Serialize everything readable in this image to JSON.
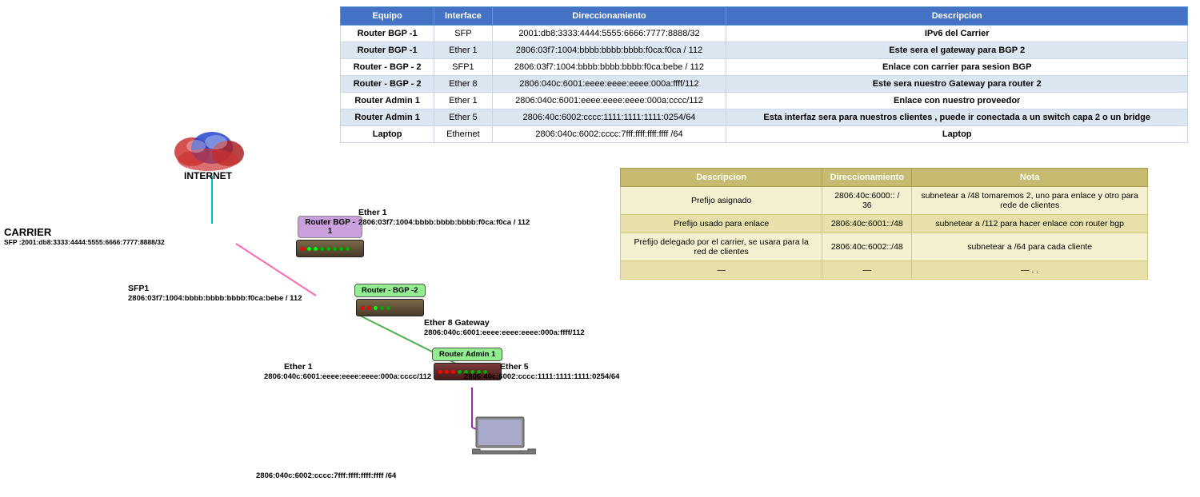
{
  "mainTable": {
    "headers": [
      "Equipo",
      "Interface",
      "Direccionamiento",
      "Descripcion"
    ],
    "rows": [
      {
        "equipo": "Router BGP -1",
        "interface": "SFP",
        "direccionamiento": "2001:db8:3333:4444:5555:6666:7777:8888/32",
        "descripcion": "IPv6 del Carrier"
      },
      {
        "equipo": "Router BGP -1",
        "interface": "Ether 1",
        "direccionamiento": "2806:03f7:1004:bbbb:bbbb:bbbb:f0ca:f0ca / 112",
        "descripcion": "Este sera el gateway para BGP 2"
      },
      {
        "equipo": "Router - BGP - 2",
        "interface": "SFP1",
        "direccionamiento": "2806:03f7:1004:bbbb:bbbb:bbbb:f0ca:bebe / 112",
        "descripcion": "Enlace con carrier para sesion BGP"
      },
      {
        "equipo": "Router - BGP - 2",
        "interface": "Ether 8",
        "direccionamiento": "2806:040c:6001:eeee:eeee:eeee:000a:ffff/112",
        "descripcion": "Este sera nuestro Gateway para router 2"
      },
      {
        "equipo": "Router Admin 1",
        "interface": "Ether 1",
        "direccionamiento": "2806:040c:6001:eeee:eeee:eeee:000a:cccc/112",
        "descripcion": "Enlace con nuestro proveedor"
      },
      {
        "equipo": "Router Admin 1",
        "interface": "Ether 5",
        "direccionamiento": "2806:40c:6002:cccc:1111:1111:1111:0254/64",
        "descripcion": "Esta interfaz sera para nuestros clientes , puede ir conectada a un switch capa 2 o un bridge"
      },
      {
        "equipo": "Laptop",
        "interface": "Ethernet",
        "direccionamiento": "2806:040c:6002:cccc:7fff:ffff:ffff:ffff /64",
        "descripcion": "Laptop"
      }
    ]
  },
  "secondaryTable": {
    "headers": [
      "Descripcion",
      "Direccionamiento",
      "Nota"
    ],
    "rows": [
      {
        "descripcion": "Prefijo asignado",
        "direccionamiento": "2806:40c:6000:: / 36",
        "nota": "subnetear a /48  tomaremos 2, uno para enlace y otro para rede de clientes"
      },
      {
        "descripcion": "Prefijo usado para enlace",
        "direccionamiento": "2806:40c:6001::/48",
        "nota": "subnetear a /112 para hacer enlace con router bgp"
      },
      {
        "descripcion": "Prefijo delegado por el carrier, se usara para la red de clientes",
        "direccionamiento": "2806:40c:6002::/48",
        "nota": "subnetear a /64 para cada cliente"
      },
      {
        "descripcion": "—",
        "direccionamiento": "—",
        "nota": "— . ."
      }
    ]
  },
  "diagram": {
    "internet_label": "INTERNET",
    "carrier_label": "CARRIER",
    "carrier_sfp": "SFP :2001:db8:3333:4444:5555:6666:7777:8888/32",
    "router_bgp1_label": "Router BGP -\n1",
    "router_bgp1_ether1": "Ether 1",
    "router_bgp1_ether1_addr": "2806:03f7:1004:bbbb:bbbb:bbbb:f0ca:f0ca / 112",
    "router_bgp2_label": "Router - BGP -2",
    "router_bgp2_sfp1": "SFP1",
    "router_bgp2_sfp1_addr": "2806:03f7:1004:bbbb:bbbb:bbbb:f0ca:bebe / 112",
    "router_bgp2_ether8": "Ether 8 Gateway",
    "router_bgp2_ether8_addr": "2806:040c:6001:eeee:eeee:eeee:000a:ffff/112",
    "router_admin1_label": "Router Admin 1",
    "router_admin1_ether1": "Ether 1",
    "router_admin1_ether1_addr": "2806:040c:6001:eeee:eeee:eeee:000a:cccc/112",
    "router_admin1_ether5": "Ether 5",
    "router_admin1_ether5_addr": "2806:40c:6002:cccc:1111:1111:1111:0254/64",
    "laptop_addr": "2806:040c:6002:cccc:7fff:ffff:ffff:ffff /64"
  }
}
